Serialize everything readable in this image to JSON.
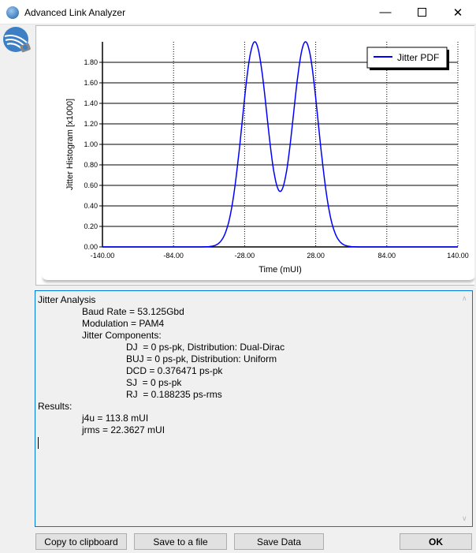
{
  "window": {
    "title": "Advanced Link Analyzer"
  },
  "chart_data": {
    "type": "line",
    "title": "",
    "xlabel": "Time (mUI)",
    "ylabel": "Jitter Histogram [x1000]",
    "xlim": [
      -140,
      140
    ],
    "ylim": [
      0,
      2.0
    ],
    "xticks": [
      "-140.00",
      "-84.00",
      "-28.00",
      "28.00",
      "84.00",
      "140.00"
    ],
    "xtick_values": [
      -140,
      -84,
      -28,
      28,
      84,
      140
    ],
    "yticks": [
      "0.00",
      "0.20",
      "0.40",
      "0.60",
      "0.80",
      "1.00",
      "1.20",
      "1.40",
      "1.60",
      "1.80"
    ],
    "ytick_values": [
      0,
      0.2,
      0.4,
      0.6,
      0.8,
      1.0,
      1.2,
      1.4,
      1.6,
      1.8
    ],
    "grid": true,
    "legend_position": "top-right",
    "series": [
      {
        "name": "Jitter PDF",
        "color": "#0000ff",
        "model": "dual-gaussian",
        "means": [
          -20,
          20
        ],
        "sigma": 10,
        "amplitude": 2.0,
        "x": [
          -140,
          -60,
          -50,
          -45,
          -40,
          -35,
          -30,
          -25,
          -20,
          -15,
          -10,
          -5,
          0,
          5,
          10,
          15,
          20,
          25,
          30,
          35,
          40,
          45,
          50,
          60,
          140
        ],
        "y": [
          0,
          0,
          0.02,
          0.09,
          0.27,
          0.65,
          1.21,
          1.77,
          2.0,
          1.77,
          1.24,
          0.77,
          0.54,
          0.77,
          1.24,
          1.77,
          2.0,
          1.77,
          1.21,
          0.65,
          0.27,
          0.09,
          0.02,
          0,
          0
        ]
      }
    ]
  },
  "report": {
    "heading": "Jitter Analysis",
    "baud_rate": "Baud Rate = 53.125Gbd",
    "modulation": "Modulation = PAM4",
    "components_label": "Jitter Components:",
    "dj": "DJ  = 0 ps-pk, Distribution: Dual-Dirac",
    "buj": "BUJ = 0 ps-pk, Distribution: Uniform",
    "dcd": "DCD = 0.376471 ps-pk",
    "sj": "SJ  = 0 ps-pk",
    "rj": "RJ  = 0.188235 ps-rms",
    "results_label": "Results:",
    "j4u": "j4u = 113.8 mUI",
    "jrms": "jrms = 22.3627 mUI"
  },
  "buttons": {
    "copy": "Copy to clipboard",
    "save_file": "Save to a file",
    "save_data": "Save Data",
    "ok": "OK"
  }
}
